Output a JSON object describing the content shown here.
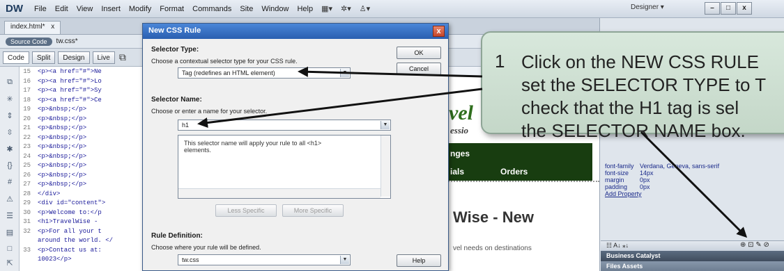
{
  "app": {
    "logo": "DW",
    "menu": [
      "File",
      "Edit",
      "View",
      "Insert",
      "Modify",
      "Format",
      "Commands",
      "Site",
      "Window",
      "Help"
    ],
    "workspace": "Designer",
    "window_buttons": [
      "–",
      "□",
      "x"
    ]
  },
  "document": {
    "tab": "index.html*",
    "tab_close": "x",
    "source_badge": "Source Code",
    "related_file": "tw.css*",
    "view_buttons": [
      "Code",
      "Split",
      "Design",
      "Live"
    ],
    "code_lines": [
      {
        "num": "15",
        "text": "<p><a href=\"#\">Ne"
      },
      {
        "num": "16",
        "text": "<p><a href=\"#\">Lo"
      },
      {
        "num": "17",
        "text": "<p><a href=\"#\">Sy"
      },
      {
        "num": "18",
        "text": "<p><a href=\"#\">Ce"
      },
      {
        "num": "19",
        "text": "<p>&nbsp;</p>"
      },
      {
        "num": "20",
        "text": "<p>&nbsp;</p>"
      },
      {
        "num": "21",
        "text": "<p>&nbsp;</p>"
      },
      {
        "num": "22",
        "text": "<p>&nbsp;</p>"
      },
      {
        "num": "23",
        "text": "<p>&nbsp;</p>"
      },
      {
        "num": "24",
        "text": "<p>&nbsp;</p>"
      },
      {
        "num": "25",
        "text": "<p>&nbsp;</p>"
      },
      {
        "num": "26",
        "text": "<p>&nbsp;</p>"
      },
      {
        "num": "27",
        "text": "<p>&nbsp;</p>"
      },
      {
        "num": "28",
        "text": "</div>"
      },
      {
        "num": "29",
        "text": "<div id=\"content\">"
      },
      {
        "num": "30",
        "text": "<p>Welcome to:</p"
      },
      {
        "num": "31",
        "text": "<h1>TravelWise -"
      },
      {
        "num": "32",
        "text": "<p>For all your t"
      },
      {
        "num": "",
        "text": "around the world. </"
      },
      {
        "num": "33",
        "text": "<p>Contact us at:"
      },
      {
        "num": "",
        "text": "10023</p>"
      }
    ]
  },
  "design": {
    "logo_fragment": "vel",
    "tagline_fragment": "essio",
    "nav_items": [
      "nges",
      "ials",
      "Orders"
    ],
    "heading_fragment": "Wise - New",
    "body_fragment": "vel needs on destinations"
  },
  "css_panel": {
    "properties": [
      {
        "name": "font-family",
        "value": "Verdana, Geneva, sans-serif"
      },
      {
        "name": "font-size",
        "value": "14px"
      },
      {
        "name": "margin",
        "value": "0px"
      },
      {
        "name": "padding",
        "value": "0px"
      }
    ],
    "add_property": "Add Property",
    "panel_header": "Business Catalyst",
    "panel_tabs": "Files  Assets"
  },
  "dialog": {
    "title": "New CSS Rule",
    "close_icon": "x",
    "selector_type_label": "Selector Type:",
    "selector_type_hint": "Choose a contextual selector type for your CSS rule.",
    "selector_type_value": "Tag (redefines an HTML element)",
    "selector_name_label": "Selector Name:",
    "selector_name_hint": "Choose or enter a name for your selector.",
    "selector_name_value": "h1",
    "description": "This selector name will apply your rule to all <h1> elements.",
    "less_specific": "Less Specific",
    "more_specific": "More Specific",
    "rule_def_label": "Rule Definition:",
    "rule_def_hint": "Choose where your rule will be defined.",
    "rule_def_value": "tw.css",
    "ok": "OK",
    "cancel": "Cancel",
    "help": "Help"
  },
  "callout": {
    "number": "1",
    "lines": [
      "Click on the NEW CSS RULE",
      "set the SELECTOR TYPE to T",
      "check that the H1 tag is sel",
      "the SELECTOR NAME box."
    ]
  }
}
